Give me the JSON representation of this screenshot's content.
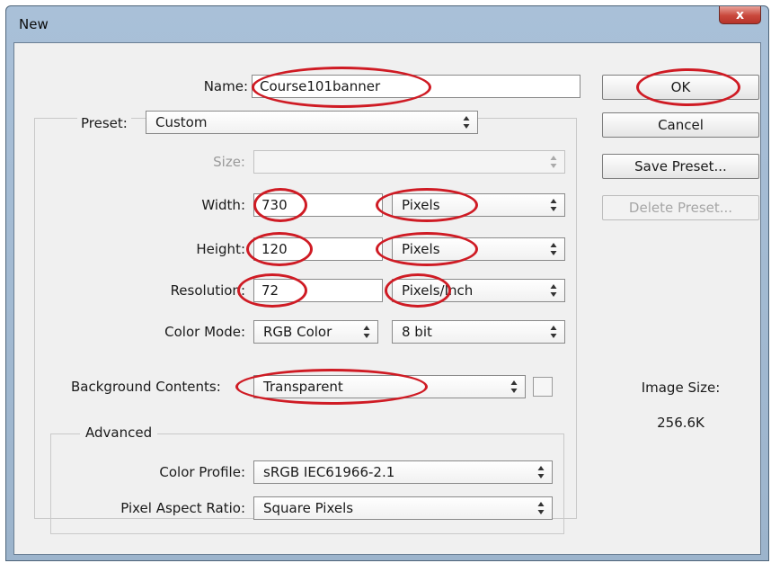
{
  "window": {
    "title": "New",
    "close_label": "x"
  },
  "form": {
    "name_label": "Name:",
    "name_value": "Course101banner",
    "preset_label": "Preset:",
    "preset_value": "Custom",
    "size_label": "Size:",
    "size_value": "",
    "width_label": "Width:",
    "width_value": "730",
    "width_unit": "Pixels",
    "height_label": "Height:",
    "height_value": "120",
    "height_unit": "Pixels",
    "resolution_label": "Resolution:",
    "resolution_value": "72",
    "resolution_unit": "Pixels/Inch",
    "color_mode_label": "Color Mode:",
    "color_mode_value": "RGB Color",
    "bit_depth_value": "8 bit",
    "background_label": "Background Contents:",
    "background_value": "Transparent",
    "advanced_label": "Advanced",
    "color_profile_label": "Color Profile:",
    "color_profile_value": "sRGB IEC61966-2.1",
    "pixel_aspect_label": "Pixel Aspect Ratio:",
    "pixel_aspect_value": "Square Pixels"
  },
  "buttons": {
    "ok": "OK",
    "cancel": "Cancel",
    "save_preset": "Save Preset...",
    "delete_preset": "Delete Preset..."
  },
  "info": {
    "image_size_label": "Image Size:",
    "image_size_value": "256.6K"
  },
  "annotation_color": "#cf1b24"
}
